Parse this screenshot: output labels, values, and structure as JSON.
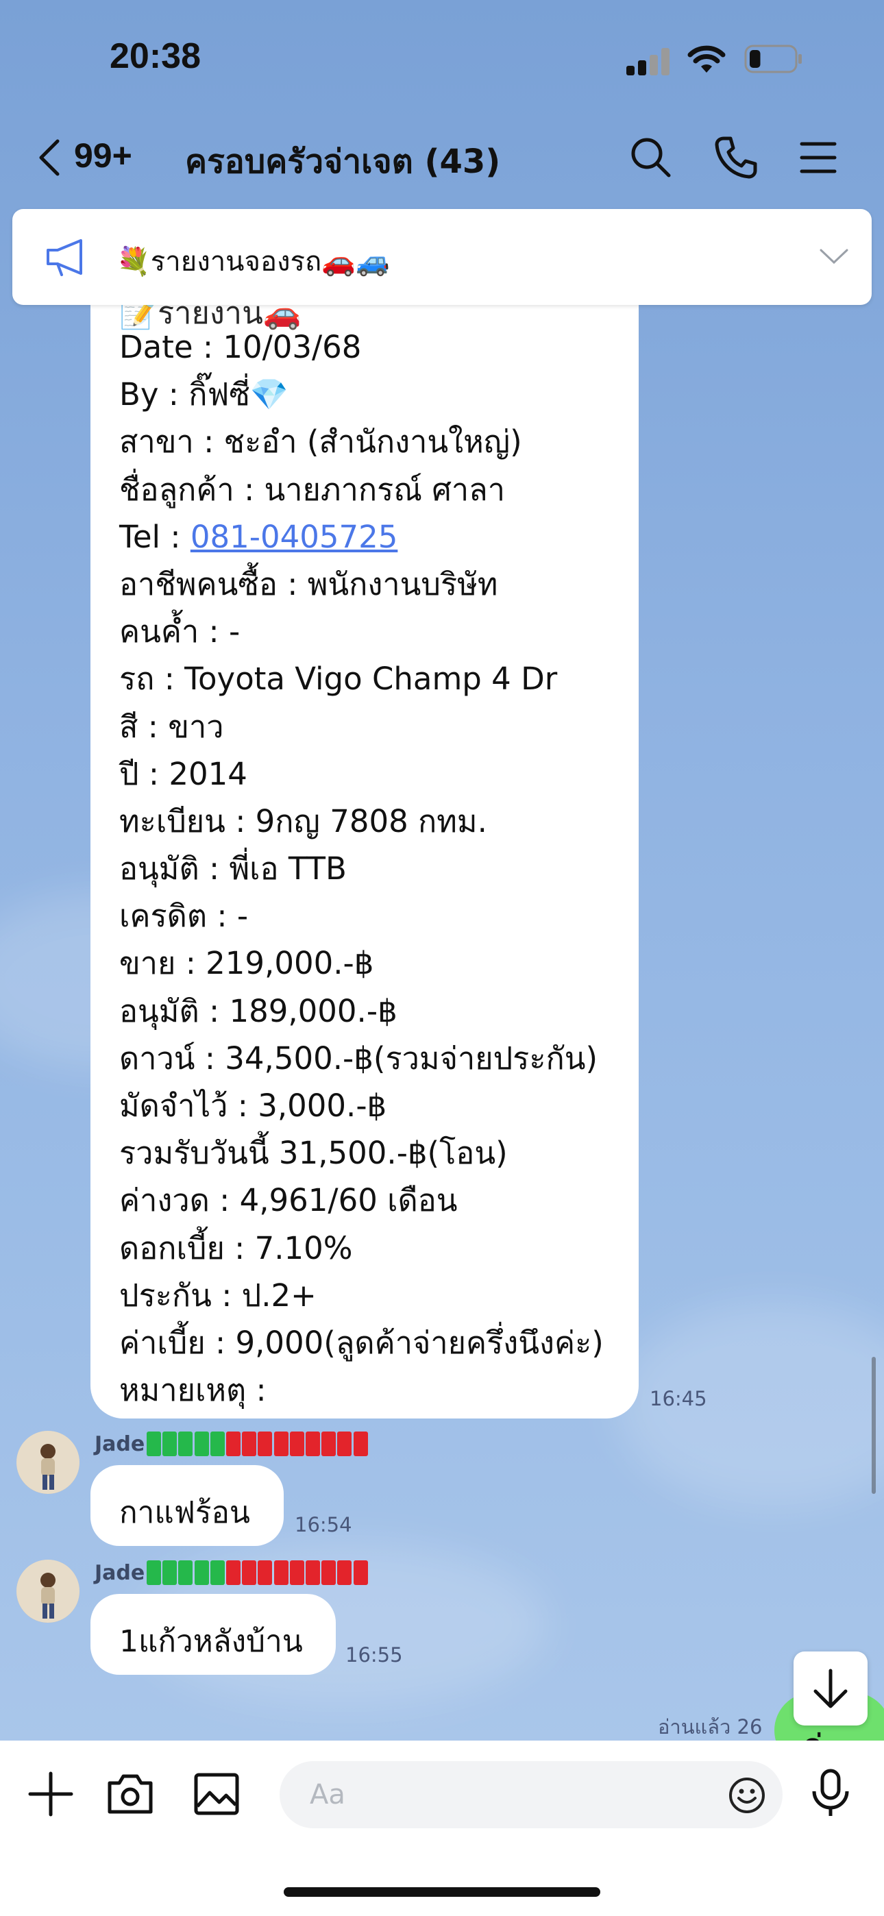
{
  "status_bar": {
    "time": "20:38",
    "battery_level": 0.25
  },
  "header": {
    "unread_count": "99+",
    "title": "ครอบครัวจ่าเจต (43)",
    "icons": [
      "back-icon",
      "search-icon",
      "phone-icon",
      "menu-icon"
    ]
  },
  "announcement": {
    "text": "💐รายงานจองรถ🚗🚙"
  },
  "message_report": {
    "cutoff": "📝รายงาน🚗",
    "lines": [
      "Date : 10/03/68",
      "By : กิ๊ฟซี่💎",
      "สาขา : ชะอำ (สำนักงานใหญ่)",
      "ชื่อลูกค้า : นายภากรณ์ ศาลา",
      "Tel : ",
      "อาชีพคนซื้อ : พนักงานบริษัท",
      "คนค้ำ : -",
      "รถ : Toyota Vigo Champ 4 Dr",
      "สี : ขาว",
      "ปี : 2014",
      "ทะเบียน : 9กญ 7808 กทม.",
      "อนุมัติ : พี่เอ TTB",
      "เครดิต : -",
      "ขาย : 219,000.-฿",
      "อนุมัติ : 189,000.-฿",
      "ดาวน์ : 34,500.-฿(รวมจ่ายประกัน)",
      "มัดจำไว้ : 3,000.-฿",
      "รวมรับวันนี้ 31,500.-฿(โอน)",
      "ค่างวด : 4,961/60 เดือน",
      "ดอกเบี้ย : 7.10%",
      "ประกัน : ป.2+",
      "ค่าเบี้ย : 9,000(ลูดค้าจ่ายครึ่งนึงค่ะ)",
      "หมายเหตุ :"
    ],
    "tel_link": "081-0405725",
    "time": "16:45"
  },
  "messages": [
    {
      "sender": "Jade",
      "text": "กาแฟร้อน",
      "time": "16:54"
    },
    {
      "sender": "Jade",
      "text": "1แก้วหลังบ้าน",
      "time": "16:55"
    }
  ],
  "sender_badges": {
    "green": 5,
    "red": 9
  },
  "read_status": "อ่านแล้ว 26",
  "own_message": {
    "text": "ค่ะ"
  },
  "input": {
    "placeholder": "Aa",
    "icons": [
      "plus-icon",
      "camera-icon",
      "image-icon",
      "emoji-icon",
      "microphone-icon"
    ]
  },
  "colors": {
    "link": "#4b77e8",
    "badge_green": "#25b84b",
    "badge_red": "#e3242b",
    "own_bubble": "#6ee06d"
  }
}
